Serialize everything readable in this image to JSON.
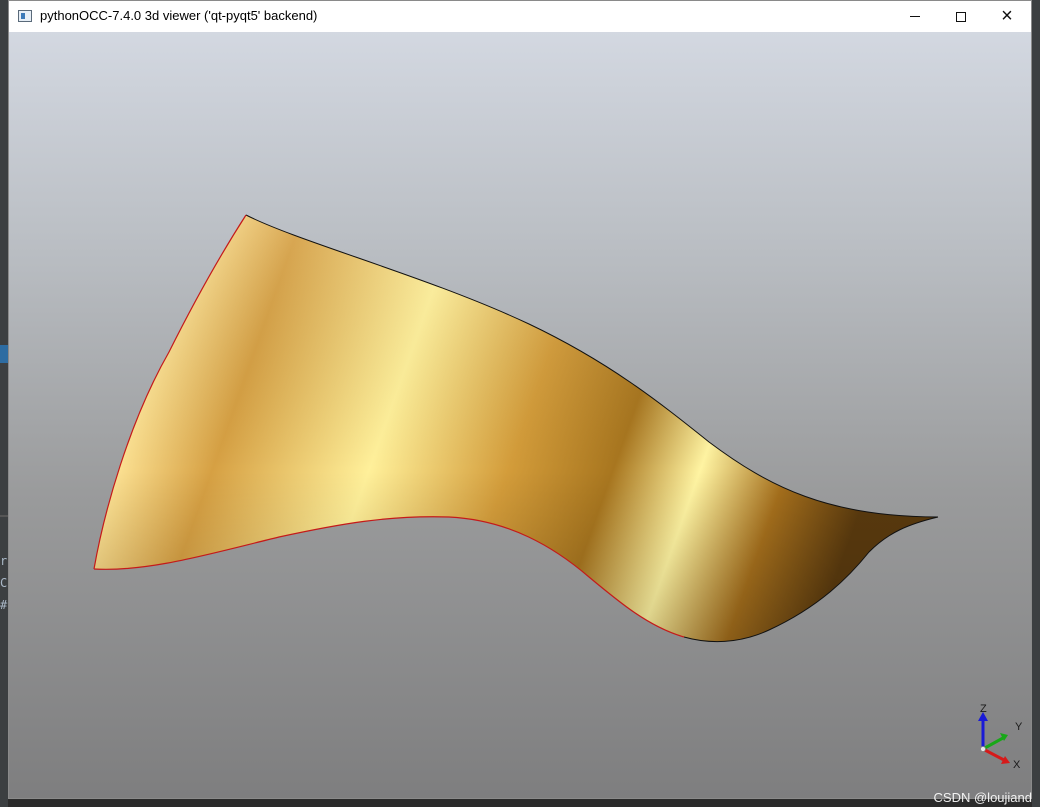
{
  "window": {
    "title": "pythonOCC-7.4.0 3d viewer ('qt-pyqt5' backend)",
    "icon": "app-window-icon",
    "controls": {
      "minimize": "minimize-icon",
      "maximize": "maximize-icon",
      "close": "×"
    }
  },
  "viewer": {
    "background_top": "#d3d8e1",
    "background_bottom": "#7e7e7f",
    "surface_color": "#e8b348",
    "edge_highlight_color": "#e02020",
    "triedron": {
      "z_label": "Z",
      "y_label": "Y",
      "x_label": "X",
      "z_color": "#1a1ad6",
      "y_color": "#18a818",
      "x_color": "#d61a1a"
    }
  },
  "watermark": "CSDN @loujiand",
  "background_editor": {
    "line1": "r[",
    "line2": "C(",
    "line3": "#"
  }
}
